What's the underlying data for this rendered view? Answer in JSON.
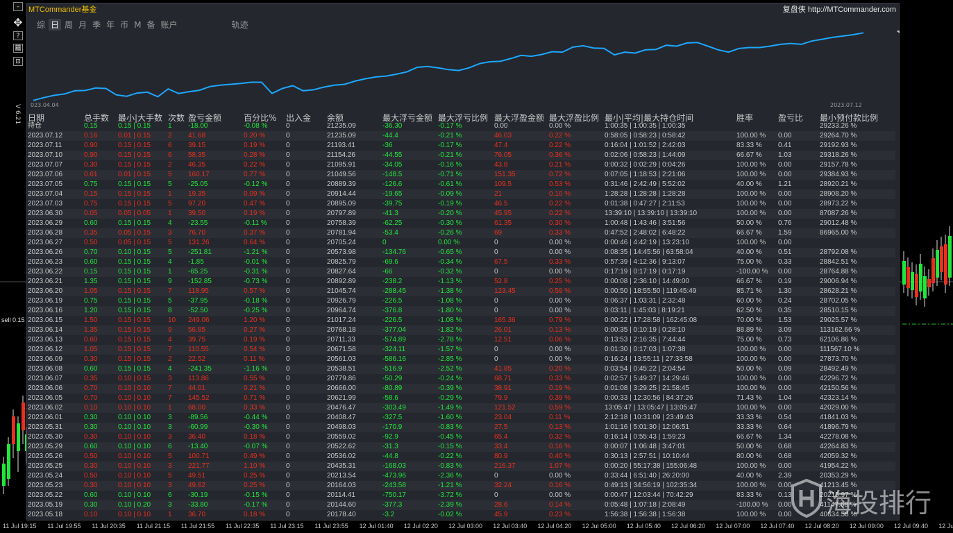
{
  "app": {
    "brand": "MTCommander基金",
    "brand_right": "复盘侠 http://MTCommander.com",
    "version": "V 6.21",
    "sell_label": "sell 0.15"
  },
  "tabs": [
    "综",
    "日",
    "周",
    "月",
    "季",
    "年",
    "币",
    "M",
    "备",
    "账户",
    "轨迹"
  ],
  "active_tab": "日",
  "toolbar": {
    "minimize": "–",
    "move": "✥",
    "help": "?",
    "mode": "䨻",
    "reset": "⊡"
  },
  "equity_chart": {
    "start_label": "023.04.04",
    "end_label": "2023.07.12",
    "line_color": "#1ea7ff"
  },
  "chart_data": {
    "type": "line",
    "x": [
      "2023.04.04",
      "2023.07.12"
    ],
    "values": [
      20050,
      20110,
      20160,
      20190,
      20260,
      20265,
      20320,
      20310,
      20170,
      20140,
      20210,
      20230,
      20130,
      20300,
      20200,
      20240,
      20270,
      20350,
      20380,
      20400,
      20420,
      20445,
      20445,
      20200,
      20310,
      20370,
      20260,
      20280,
      20340,
      20380,
      20400,
      20470,
      20520,
      20560,
      20580,
      20620,
      20670,
      20770,
      20790,
      20760,
      20720,
      20700,
      20760,
      20850,
      20890,
      20900,
      20960,
      21030,
      21010,
      21050,
      21110,
      21100,
      21210,
      21240,
      21190,
      21180,
      21040,
      21100,
      21080,
      21150,
      21160,
      21250,
      21230,
      21300,
      21310,
      21230,
      21150,
      21100,
      21180,
      21200,
      21200,
      21230,
      21270,
      21290,
      21270,
      21340,
      21380,
      21420,
      21450,
      21480,
      21520
    ],
    "color": "#1ea7ff"
  },
  "table": {
    "headers": [
      "日期",
      "总手数",
      "最小|大手数",
      "次数",
      "盈亏金额",
      "百分比%",
      "出入金",
      "余额",
      "最大浮亏金额",
      "最大浮亏比例",
      "最大浮盈金额",
      "最大浮盈比例",
      "最小|平均|最大持仓时间",
      "胜率",
      "盈亏比",
      "最小预付款比例"
    ],
    "colors": {
      "green": "#22e63c",
      "red": "#e8301e",
      "white": "#c8c8c8"
    },
    "rows": [
      {
        "c": "green",
        "d": [
          "持仓",
          "0.15",
          "0.15 | 0.15",
          "1",
          "-18.00",
          "-0.08 %",
          "0",
          "21235.09",
          "-36.30",
          "-0.17 %",
          "0.00",
          "0.00 %",
          "1:00:35 | 1:00:35 | 1:00:35",
          "",
          "",
          "29233.26 %"
        ]
      },
      {
        "c": "red",
        "d": [
          "2023.07.12",
          "0.16",
          "0.01 | 0.15",
          "2",
          "41.68",
          "0.20 %",
          "0",
          "21235.09",
          "-44.4",
          "-0.21 %",
          "46.03",
          "0.22 %",
          "0:58:05 | 0:58:23 | 0:58:42",
          "100.00 %",
          "0.00",
          "29264.70 %"
        ]
      },
      {
        "c": "red",
        "d": [
          "2023.07.11",
          "0.90",
          "0.15 | 0.15",
          "6",
          "39.15",
          "0.19 %",
          "0",
          "21193.41",
          "-36",
          "-0.17 %",
          "47.4",
          "0.22 %",
          "0:16:04 | 1:01:52 | 2:42:03",
          "83.33 %",
          "0.41",
          "29192.93 %"
        ]
      },
      {
        "c": "red",
        "d": [
          "2023.07.10",
          "0.90",
          "0.15 | 0.15",
          "6",
          "58.35",
          "0.28 %",
          "0",
          "21154.26",
          "-44.55",
          "-0.21 %",
          "76.05",
          "0.36 %",
          "0:02:06 | 0:58:23 | 1:44:09",
          "66.67 %",
          "1.03",
          "29318.26 %"
        ]
      },
      {
        "c": "red",
        "d": [
          "2023.07.07",
          "0.30",
          "0.15 | 0.15",
          "2",
          "46.35",
          "0.22 %",
          "0",
          "21095.91",
          "-34.05",
          "-0.16 %",
          "43.8",
          "0.21 %",
          "0:00:32 | 0:02:29 | 0:04:26",
          "100.00 %",
          "0.00",
          "29157.78 %"
        ]
      },
      {
        "c": "red",
        "d": [
          "2023.07.06",
          "0.61",
          "0.01 | 0.15",
          "5",
          "160.17",
          "0.77 %",
          "0",
          "21049.56",
          "-148.5",
          "-0.71 %",
          "151.35",
          "0.72 %",
          "0:07:05 | 1:18:53 | 2:21:06",
          "100.00 %",
          "0.00",
          "29384.93 %"
        ]
      },
      {
        "c": "green",
        "d": [
          "2023.07.05",
          "0.75",
          "0.15 | 0.15",
          "5",
          "-25.05",
          "-0.12 %",
          "0",
          "20889.39",
          "-126.6",
          "-0.61 %",
          "109.5",
          "0.53 %",
          "0:31:46 | 2:42:49 | 5:52:02",
          "40.00 %",
          "1.21",
          "28920.21 %"
        ]
      },
      {
        "c": "red",
        "d": [
          "2023.07.04",
          "0.15",
          "0.15 | 0.15",
          "1",
          "19.35",
          "0.09 %",
          "0",
          "20914.44",
          "-19.65",
          "-0.09 %",
          "21",
          "0.10 %",
          "1:28:28 | 1:28:28 | 1:28:28",
          "100.00 %",
          "0.00",
          "28908.20 %"
        ]
      },
      {
        "c": "red",
        "d": [
          "2023.07.03",
          "0.75",
          "0.15 | 0.15",
          "5",
          "97.20",
          "0.47 %",
          "0",
          "20895.09",
          "-39.75",
          "-0.19 %",
          "46.5",
          "0.22 %",
          "0:01:38 | 0:47:27 | 2:11:53",
          "100.00 %",
          "0.00",
          "28973.22 %"
        ]
      },
      {
        "c": "red",
        "d": [
          "2023.06.30",
          "0.05",
          "0.05 | 0.05",
          "1",
          "39.50",
          "0.19 %",
          "0",
          "20797.89",
          "-41.3",
          "-0.20 %",
          "45.95",
          "0.22 %",
          "13:39:10 | 13:39:10 | 13:39:10",
          "100.00 %",
          "0.00",
          "87087.26 %"
        ]
      },
      {
        "c": "green",
        "d": [
          "2023.06.29",
          "0.60",
          "0.15 | 0.15",
          "4",
          "-23.55",
          "-0.11 %",
          "0",
          "20758.39",
          "-62.25",
          "-0.30 %",
          "61.35",
          "0.30 %",
          "1:00:48 | 1:43:46 | 3:51:56",
          "50.00 %",
          "0.76",
          "29012.48 %"
        ]
      },
      {
        "c": "red",
        "d": [
          "2023.06.28",
          "0.35",
          "0.05 | 0.15",
          "3",
          "76.70",
          "0.37 %",
          "0",
          "20781.94",
          "-53.4",
          "-0.26 %",
          "69",
          "0.33 %",
          "0:47:52 | 2:48:02 | 6:48:22",
          "66.67 %",
          "1.59",
          "86965.00 %"
        ]
      },
      {
        "c": "red",
        "d": [
          "2023.06.27",
          "0.50",
          "0.05 | 0.15",
          "5",
          "131.26",
          "0.64 %",
          "0",
          "20705.24",
          "0",
          "0.00 %",
          "0",
          "0.00 %",
          "0:00:46 | 4:42:19 | 13:23:10",
          "100.00 %",
          "0.00",
          ""
        ]
      },
      {
        "c": "green",
        "d": [
          "2023.06.26",
          "0.70",
          "0.10 | 0.15",
          "5",
          "-251.81",
          "-1.21 %",
          "0",
          "20573.98",
          "-134.76",
          "-0.65 %",
          "0",
          "0.00 %",
          "0:08:35 | 14:45:56 | 63:58:04",
          "40.00 %",
          "0.51",
          "28792.08 %"
        ]
      },
      {
        "c": "green",
        "d": [
          "2023.06.23",
          "0.60",
          "0.15 | 0.15",
          "4",
          "-1.85",
          "-0.01 %",
          "0",
          "20825.79",
          "-69.6",
          "-0.34 %",
          "67.5",
          "0.33 %",
          "0:57:39 | 4:12:36 | 9:13:07",
          "75.00 %",
          "0.33",
          "28842.51 %"
        ]
      },
      {
        "c": "green",
        "d": [
          "2023.06.22",
          "0.15",
          "0.15 | 0.15",
          "1",
          "-65.25",
          "-0.31 %",
          "0",
          "20827.64",
          "-66",
          "-0.32 %",
          "0",
          "0.00 %",
          "0:17:19 | 0:17:19 | 0:17:19",
          "-100.00 %",
          "0.00",
          "28764.88 %"
        ]
      },
      {
        "c": "green",
        "d": [
          "2023.06.21",
          "1.35",
          "0.15 | 0.15",
          "9",
          "-152.85",
          "-0.73 %",
          "0",
          "20892.89",
          "-238.2",
          "-1.13 %",
          "52.8",
          "0.25 %",
          "0:00:08 | 2:36:10 | 14:49:00",
          "66.67 %",
          "0.19",
          "29006.94 %"
        ]
      },
      {
        "c": "red",
        "d": [
          "2023.06.20",
          "1.05",
          "0.15 | 0.15",
          "7",
          "118.95",
          "0.57 %",
          "0",
          "21045.74",
          "-288.45",
          "-1.38 %",
          "123.45",
          "0.59 %",
          "0:00:50 | 18:55:50 | 119:45:49",
          "85.71 %",
          "1.30",
          "28628.21 %"
        ]
      },
      {
        "c": "green",
        "d": [
          "2023.06.19",
          "0.75",
          "0.15 | 0.15",
          "5",
          "-37.95",
          "-0.18 %",
          "0",
          "20926.79",
          "-226.5",
          "-1.08 %",
          "0",
          "0.00 %",
          "0:06:37 | 1:03:31 | 2:32:48",
          "60.00 %",
          "0.24",
          "28702.05 %"
        ]
      },
      {
        "c": "green",
        "d": [
          "2023.06.16",
          "1.20",
          "0.15 | 0.15",
          "8",
          "-52.50",
          "-0.25 %",
          "0",
          "20964.74",
          "-376.8",
          "-1.80 %",
          "0",
          "0.00 %",
          "0:03:11 | 1:45:03 | 8:19:21",
          "62.50 %",
          "0.35",
          "28510.15 %"
        ]
      },
      {
        "c": "red",
        "d": [
          "2023.06.15",
          "1.50",
          "0.15 | 0.15",
          "10",
          "249.06",
          "1.20 %",
          "0",
          "21017.24",
          "-226.5",
          "-1.08 %",
          "165.36",
          "0.79 %",
          "0:00:22 | 17:28:58 | 162:45:08",
          "70.00 %",
          "1.53",
          "29025.57 %"
        ]
      },
      {
        "c": "red",
        "d": [
          "2023.06.14",
          "1.35",
          "0.15 | 0.15",
          "9",
          "56.85",
          "0.27 %",
          "0",
          "20768.18",
          "-377.04",
          "-1.82 %",
          "26.01",
          "0.13 %",
          "0:00:35 | 0:10:19 | 0:28:10",
          "88.89 %",
          "3.09",
          "113162.66 %"
        ]
      },
      {
        "c": "red",
        "d": [
          "2023.06.13",
          "0.60",
          "0.15 | 0.15",
          "4",
          "39.75",
          "0.19 %",
          "0",
          "20711.33",
          "-574.89",
          "-2.78 %",
          "12.51",
          "0.06 %",
          "0:13:53 | 2:16:35 | 7:44:44",
          "75.00 %",
          "0.73",
          "62106.86 %"
        ]
      },
      {
        "c": "red",
        "d": [
          "2023.06.12",
          "1.05",
          "0.15 | 0.15",
          "7",
          "110.55",
          "0.54 %",
          "0",
          "20671.58",
          "-324.11",
          "-1.57 %",
          "0",
          "0.00 %",
          "0:01:30 | 0:17:03 | 1:07:38",
          "100.00 %",
          "0.00",
          "111567.10 %"
        ]
      },
      {
        "c": "red",
        "d": [
          "2023.06.09",
          "0.30",
          "0.15 | 0.15",
          "2",
          "22.52",
          "0.11 %",
          "0",
          "20561.03",
          "-586.16",
          "-2.85 %",
          "0",
          "0.00 %",
          "0:16:24 | 13:55:11 | 27:33:58",
          "100.00 %",
          "0.00",
          "27873.70 %"
        ]
      },
      {
        "c": "green",
        "d": [
          "2023.06.08",
          "0.60",
          "0.15 | 0.15",
          "4",
          "-241.35",
          "-1.16 %",
          "0",
          "20538.51",
          "-516.9",
          "-2.52 %",
          "41.85",
          "0.20 %",
          "0:03:54 | 0:45:22 | 2:04:54",
          "50.00 %",
          "0.09",
          "28492.49 %"
        ]
      },
      {
        "c": "red",
        "d": [
          "2023.06.07",
          "0.35",
          "0.10 | 0.15",
          "3",
          "113.86",
          "0.55 %",
          "0",
          "20779.86",
          "-50.29",
          "-0.24 %",
          "68.71",
          "0.33 %",
          "0:02:57 | 5:49:37 | 14:29:46",
          "100.00 %",
          "0.00",
          "42296.72 %"
        ]
      },
      {
        "c": "red",
        "d": [
          "2023.06.06",
          "0.70",
          "0.10 | 0.10",
          "7",
          "44.01",
          "0.21 %",
          "0",
          "20666.00",
          "-80.89",
          "-0.39 %",
          "38.91",
          "0.19 %",
          "0:01:08 | 3:29:25 | 21:58:45",
          "100.00 %",
          "0.00",
          "42150.56 %"
        ]
      },
      {
        "c": "red",
        "d": [
          "2023.06.05",
          "0.70",
          "0.10 | 0.10",
          "7",
          "145.52",
          "0.71 %",
          "0",
          "20621.99",
          "-58.6",
          "-0.29 %",
          "79.9",
          "0.39 %",
          "0:00:33 | 12:30:56 | 84:37:26",
          "71.43 %",
          "1.04",
          "42323.14 %"
        ]
      },
      {
        "c": "red",
        "d": [
          "2023.06.02",
          "0.10",
          "0.10 | 0.10",
          "1",
          "68.00",
          "0.33 %",
          "0",
          "20476.47",
          "-303.49",
          "-1.49 %",
          "121.52",
          "0.59 %",
          "13:05:47 | 13:05:47 | 13:05:47",
          "100.00 %",
          "0.00",
          "42029.00 %"
        ]
      },
      {
        "c": "green",
        "d": [
          "2023.06.01",
          "0.30",
          "0.10 | 0.10",
          "3",
          "-89.56",
          "-0.44 %",
          "0",
          "20408.47",
          "-327.5",
          "-1.60 %",
          "23.04",
          "0.11 %",
          "2:12:18 | 10:31:09 | 23:49:43",
          "33.33 %",
          "0.54",
          "41841.03 %"
        ]
      },
      {
        "c": "green",
        "d": [
          "2023.05.31",
          "0.30",
          "0.10 | 0.10",
          "3",
          "-60.99",
          "-0.30 %",
          "0",
          "20498.03",
          "-170.9",
          "-0.83 %",
          "27.5",
          "0.13 %",
          "1:01:16 | 5:01:30 | 12:06:51",
          "33.33 %",
          "0.64",
          "41896.79 %"
        ]
      },
      {
        "c": "red",
        "d": [
          "2023.05.30",
          "0.30",
          "0.10 | 0.10",
          "3",
          "36.40",
          "0.18 %",
          "0",
          "20559.02",
          "-92.9",
          "-0.45 %",
          "65.4",
          "0.32 %",
          "0:16:14 | 0:55:43 | 1:59:23",
          "66.67 %",
          "1.34",
          "42278.08 %"
        ]
      },
      {
        "c": "green",
        "d": [
          "2023.05.29",
          "0.60",
          "0.10 | 0.10",
          "6",
          "-13.40",
          "-0.07 %",
          "0",
          "20522.62",
          "-31.3",
          "-0.15 %",
          "33.4",
          "0.16 %",
          "0:00:07 | 1:06:48 | 3:47:01",
          "50.00 %",
          "0.68",
          "42264.83 %"
        ]
      },
      {
        "c": "red",
        "d": [
          "2023.05.26",
          "0.50",
          "0.10 | 0.10",
          "5",
          "100.71",
          "0.49 %",
          "0",
          "20536.02",
          "-44.8",
          "-0.22 %",
          "80.9",
          "0.40 %",
          "0:30:13 | 2:57:51 | 10:10:44",
          "80.00 %",
          "0.68",
          "42059.32 %"
        ]
      },
      {
        "c": "red",
        "d": [
          "2023.05.25",
          "0.30",
          "0.10 | 0.10",
          "3",
          "221.77",
          "1.10 %",
          "0",
          "20435.31",
          "-168.03",
          "-0.83 %",
          "216.37",
          "1.07 %",
          "0:00:20 | 55:17:38 | 155:06:48",
          "100.00 %",
          "0.00",
          "41954.22 %"
        ]
      },
      {
        "c": "red",
        "d": [
          "2023.05.24",
          "0.50",
          "0.10 | 0.10",
          "5",
          "49.51",
          "0.25 %",
          "0",
          "20213.54",
          "-473.96",
          "-2.36 %",
          "0",
          "0.00 %",
          "0:33:44 | 6:51:40 | 26:20:00",
          "40.00 %",
          "2.39",
          "20353.29 %"
        ]
      },
      {
        "c": "red",
        "d": [
          "2023.05.23",
          "0.30",
          "0.10 | 0.10",
          "3",
          "49.62",
          "0.25 %",
          "0",
          "20164.03",
          "-243.58",
          "-1.21 %",
          "32.24",
          "0.16 %",
          "0:49:13 | 34:56:19 | 102:35:34",
          "100.00 %",
          "0.00",
          "41213.45 %"
        ]
      },
      {
        "c": "green",
        "d": [
          "2023.05.22",
          "0.60",
          "0.10 | 0.10",
          "6",
          "-30.19",
          "-0.15 %",
          "0",
          "20114.41",
          "-750.17",
          "-3.72 %",
          "0",
          "0.00 %",
          "0:00:47 | 12:03:44 | 70:42:29",
          "83.33 %",
          "0.13",
          "20215.97 %"
        ]
      },
      {
        "c": "green",
        "d": [
          "2023.05.19",
          "0.30",
          "0.10 | 0.20",
          "3",
          "-33.80",
          "-0.17 %",
          "0",
          "20144.60",
          "-377.3",
          "-2.39 %",
          "28.6",
          "0.14 %",
          "0:05:48 | 1:07:18 | 2:08:49",
          "-100.00 %",
          "0.00",
          "41147.68 %"
        ]
      },
      {
        "c": "red",
        "d": [
          "2023.05.18",
          "0.10",
          "0.10 | 0.10",
          "1",
          "36.70",
          "0.18 %",
          "0",
          "20178.40",
          "-3.2",
          "-0.02 %",
          "45.9",
          "0.23 %",
          "1:56:38 | 1:56:38 | 1:56:38",
          "100.00 %",
          "0.00",
          "40634.58 %"
        ]
      }
    ]
  },
  "time_axis": [
    "11 Jul 19:15",
    "11 Jul 19:55",
    "11 Jul 20:35",
    "11 Jul 21:15",
    "11 Jul 21:55",
    "11 Jul 22:35",
    "11 Jul 23:15",
    "11 Jul 23:55",
    "12 Jul 01:40",
    "12 Jul 02:20",
    "12 Jul 03:00",
    "12 Jul 03:40",
    "12 Jul 04:20",
    "12 Jul 05:00",
    "12 Jul 05:40",
    "12 Jul 06:20",
    "12 Jul 07:00",
    "12 Jul 07:40",
    "12 Jul 08:20",
    "12 Jul 09:00",
    "12 Jul 09:40",
    "12 Jul"
  ],
  "watermark": "海投排行"
}
